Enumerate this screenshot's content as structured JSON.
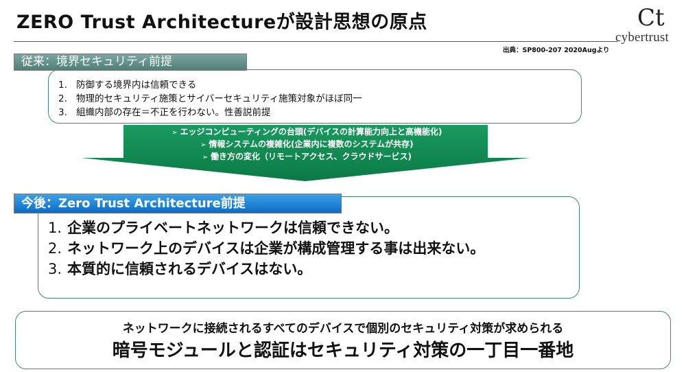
{
  "title": "ZERO Trust Architectureが設計思想の原点",
  "logo": {
    "mark": "Ct",
    "text": "cybertrust"
  },
  "source": "出典：SP800-207 2020Augより",
  "old": {
    "label": "従来：境界セキュリティ前提",
    "items": [
      {
        "num": "1.",
        "text": "防御する境界内は信頼できる"
      },
      {
        "num": "2.",
        "text": "物理的セキュリティ施策とサイバーセキュリティ施策対象がほぼ同一"
      },
      {
        "num": "3.",
        "text": "組織内部の存在＝不正を行わない。性善説前提"
      }
    ]
  },
  "reasons": {
    "marker": "➢",
    "items": [
      "エッジコンピューティングの台頭(デバイスの計算能力向上と高機能化)",
      "情報システムの複雑化(企業内に複数のシステムが共存)",
      "働き方の変化（リモートアクセス、クラウドサービス)"
    ]
  },
  "new": {
    "label": "今後：Zero Trust Architecture前提",
    "items": [
      {
        "num": "1.",
        "text": "企業のプライベートネットワークは信頼できない。"
      },
      {
        "num": "2.",
        "text": "ネットワーク上のデバイスは企業が構成管理する事は出来ない。"
      },
      {
        "num": "3.",
        "text": "本質的に信頼されるデバイスはない。"
      }
    ]
  },
  "conclusion": {
    "line1": "ネットワークに接続されるすべてのデバイスで個別のセキュリティ対策が求められる",
    "line2": "暗号モジュールと認証はセキュリティ対策の一丁目一番地"
  },
  "colors": {
    "old_label": "#5e8f88",
    "new_label": "#1a7fd4",
    "arrow": "#0e8a52",
    "box_border": "#3c8a6c"
  }
}
